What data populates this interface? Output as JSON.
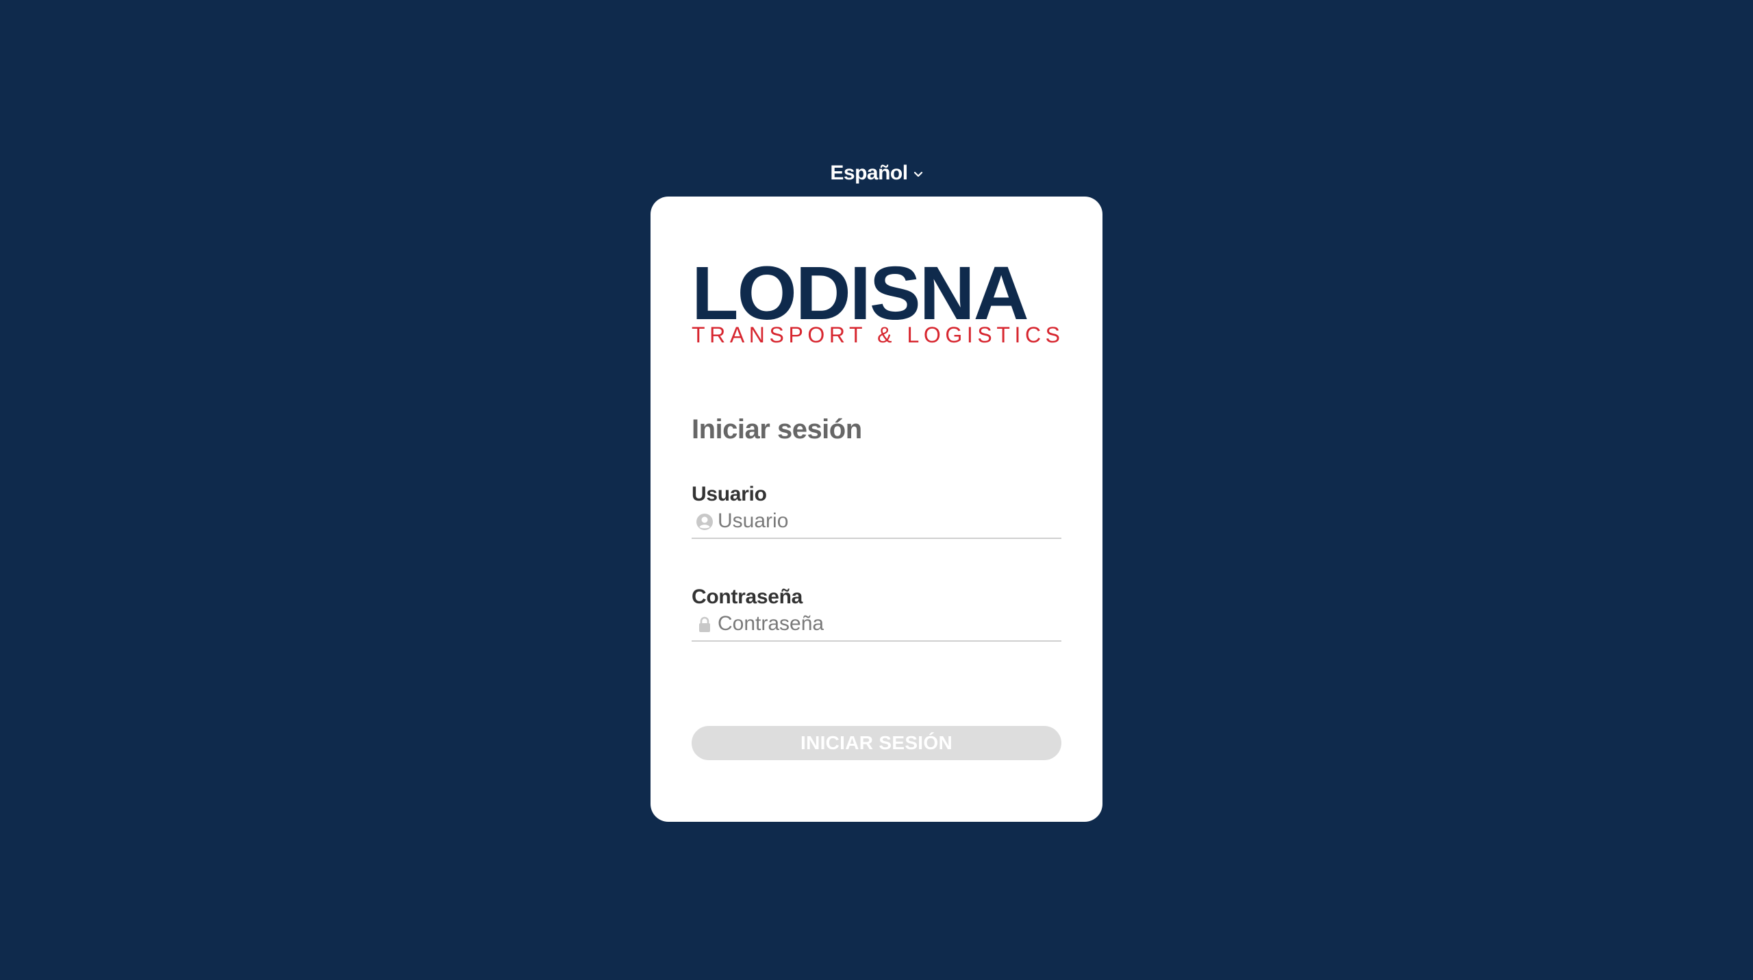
{
  "language_selector": {
    "label": "Español",
    "icon": "chevron-down-icon"
  },
  "logo": {
    "main": "LODISNA",
    "sub": "TRANSPORT & LOGISTICS"
  },
  "login": {
    "title": "Iniciar sesión",
    "username": {
      "label": "Usuario",
      "placeholder": "Usuario",
      "value": "",
      "icon": "user-icon"
    },
    "password": {
      "label": "Contraseña",
      "placeholder": "Contraseña",
      "value": "",
      "icon": "lock-icon"
    },
    "submit_label": "INICIAR SESIÓN"
  },
  "colors": {
    "background": "#0f2a4c",
    "brand_navy": "#0f2a4c",
    "brand_red": "#d7262f",
    "button_disabled": "#dddddd"
  }
}
